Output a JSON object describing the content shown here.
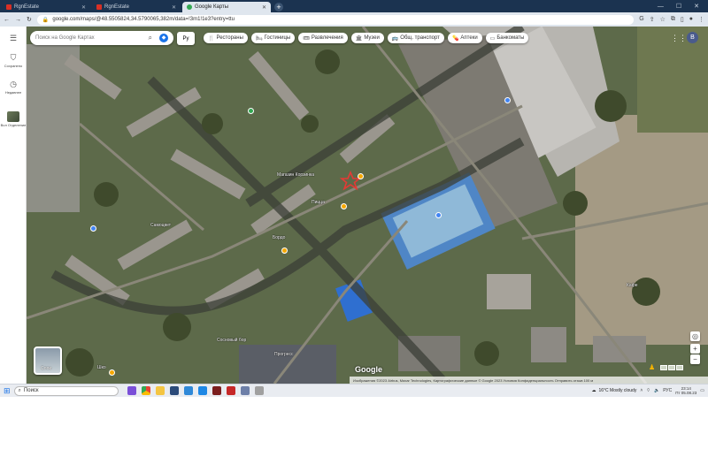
{
  "browser": {
    "tabs": [
      {
        "title": "RgnEstate",
        "favicon_color": "#d93025",
        "active": false
      },
      {
        "title": "RgnEstate",
        "favicon_color": "#d93025",
        "active": false
      },
      {
        "title": "Google Карты",
        "favicon_color": "#34a853",
        "active": true
      }
    ],
    "new_tab_label": "+",
    "url": "google.com/maps/@48.5505824,34.5790065,382m/data=!3m1!1e3?entry=ttu"
  },
  "rail": {
    "menu_icon": "hamburger-icon",
    "items": [
      {
        "label": "Сохранено",
        "icon": "bookmark-icon"
      },
      {
        "label": "Недавнее",
        "icon": "history-icon"
      },
      {
        "label": "Вол Отделение",
        "icon": "recent-place-thumbnail"
      }
    ]
  },
  "map": {
    "search_placeholder": "Поиск на Google Картах",
    "language_toggle": "Ру",
    "chips": [
      {
        "label": "Рестораны",
        "icon": "fork-knife-icon"
      },
      {
        "label": "Гостиницы",
        "icon": "bed-icon"
      },
      {
        "label": "Развлечения",
        "icon": "ticket-icon"
      },
      {
        "label": "Музеи",
        "icon": "museum-icon"
      },
      {
        "label": "Общ. транспорт",
        "icon": "bus-icon"
      },
      {
        "label": "Аптеки",
        "icon": "pill-icon"
      },
      {
        "label": "Банкоматы",
        "icon": "atm-icon"
      }
    ],
    "avatar_letter": "В",
    "place_labels": [
      {
        "text": "Магазин Корзинка"
      },
      {
        "text": "Пицца"
      },
      {
        "text": "Бордо"
      },
      {
        "text": "Сосновый бор"
      },
      {
        "text": "Самоцвет"
      },
      {
        "text": "Прогресс"
      },
      {
        "text": "Шко"
      },
      {
        "text": "Кафе"
      }
    ],
    "layers_label": "Слои",
    "google_logo": "Google",
    "attribution": "Изображения ©2023 Airbus, Maxar Technologies, Картографические данные © Google 2023  Условия  Конфиденциальность  Отправить отзыв  100 м",
    "marker_color": "#e53935"
  },
  "taskbar": {
    "search_placeholder": "Поиск",
    "weather": "16°C  Mostly cloudy",
    "language": "РУС",
    "time": "23:14",
    "date": "Пт 05.08.23",
    "app_colors": [
      "#7a4fd8",
      "#e8a317",
      "#f4c542",
      "#2b4b7a",
      "#2f89d8",
      "#1e88e5",
      "#7b1e1e",
      "#c62828",
      "#6d7fa8",
      "#a0a0a0"
    ]
  }
}
